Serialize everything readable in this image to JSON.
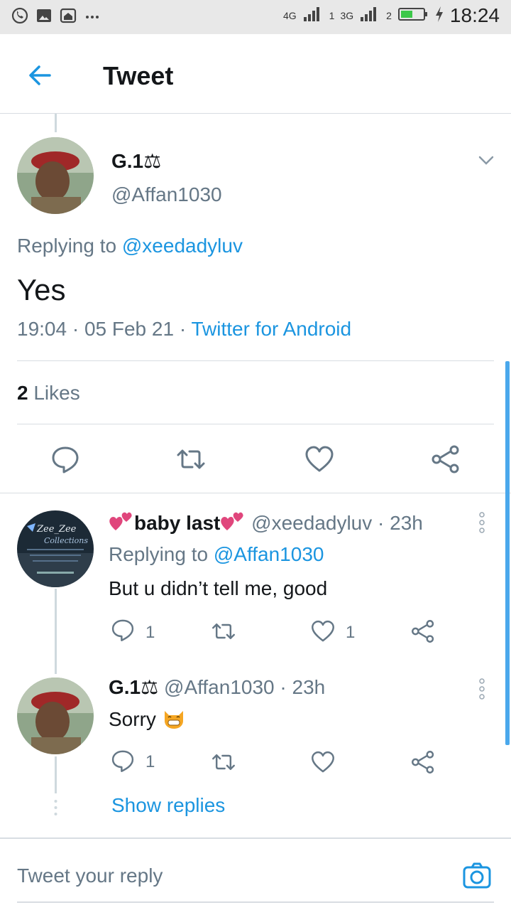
{
  "status_bar": {
    "time": "18:24",
    "net1": "4G",
    "net2": "3G",
    "sim1": "1",
    "sim2": "2"
  },
  "header": {
    "title": "Tweet"
  },
  "main_tweet": {
    "name": "G.1⚖",
    "handle": "@Affan1030",
    "replying_prefix": "Replying to",
    "replying_to": "@xeedadyluv",
    "text": "Yes",
    "time": "19:04 · 05 Feb 21 · ",
    "source": "Twitter for Android",
    "likes_count": "2",
    "likes_label": "Likes"
  },
  "replies": [
    {
      "name": "baby last",
      "handle": "@xeedadyluv",
      "age": "· 23h",
      "replying_prefix": "Replying to",
      "replying_to": "@Affan1030",
      "text": "But u didn’t tell me, good",
      "reply_count": "1",
      "retweet_count": "",
      "like_count": "1"
    },
    {
      "name": "G.1⚖",
      "handle": "@Affan1030",
      "age": "· 23h",
      "text": "Sorry",
      "reply_count": "1",
      "retweet_count": "",
      "like_count": ""
    }
  ],
  "show_replies": "Show replies",
  "reply_box": {
    "placeholder": "Tweet your reply"
  },
  "colors": {
    "accent": "#1b95e0",
    "muted": "#657786",
    "divider": "#d8dde2",
    "heart_pink": "#e0467c"
  },
  "icons": {
    "back": "arrow-left-icon",
    "more": "chevron-down-icon",
    "reply": "comment-icon",
    "retweet": "retweet-icon",
    "like": "heart-icon",
    "share": "share-icon",
    "kebab": "more-vertical-icon",
    "camera": "camera-icon"
  }
}
